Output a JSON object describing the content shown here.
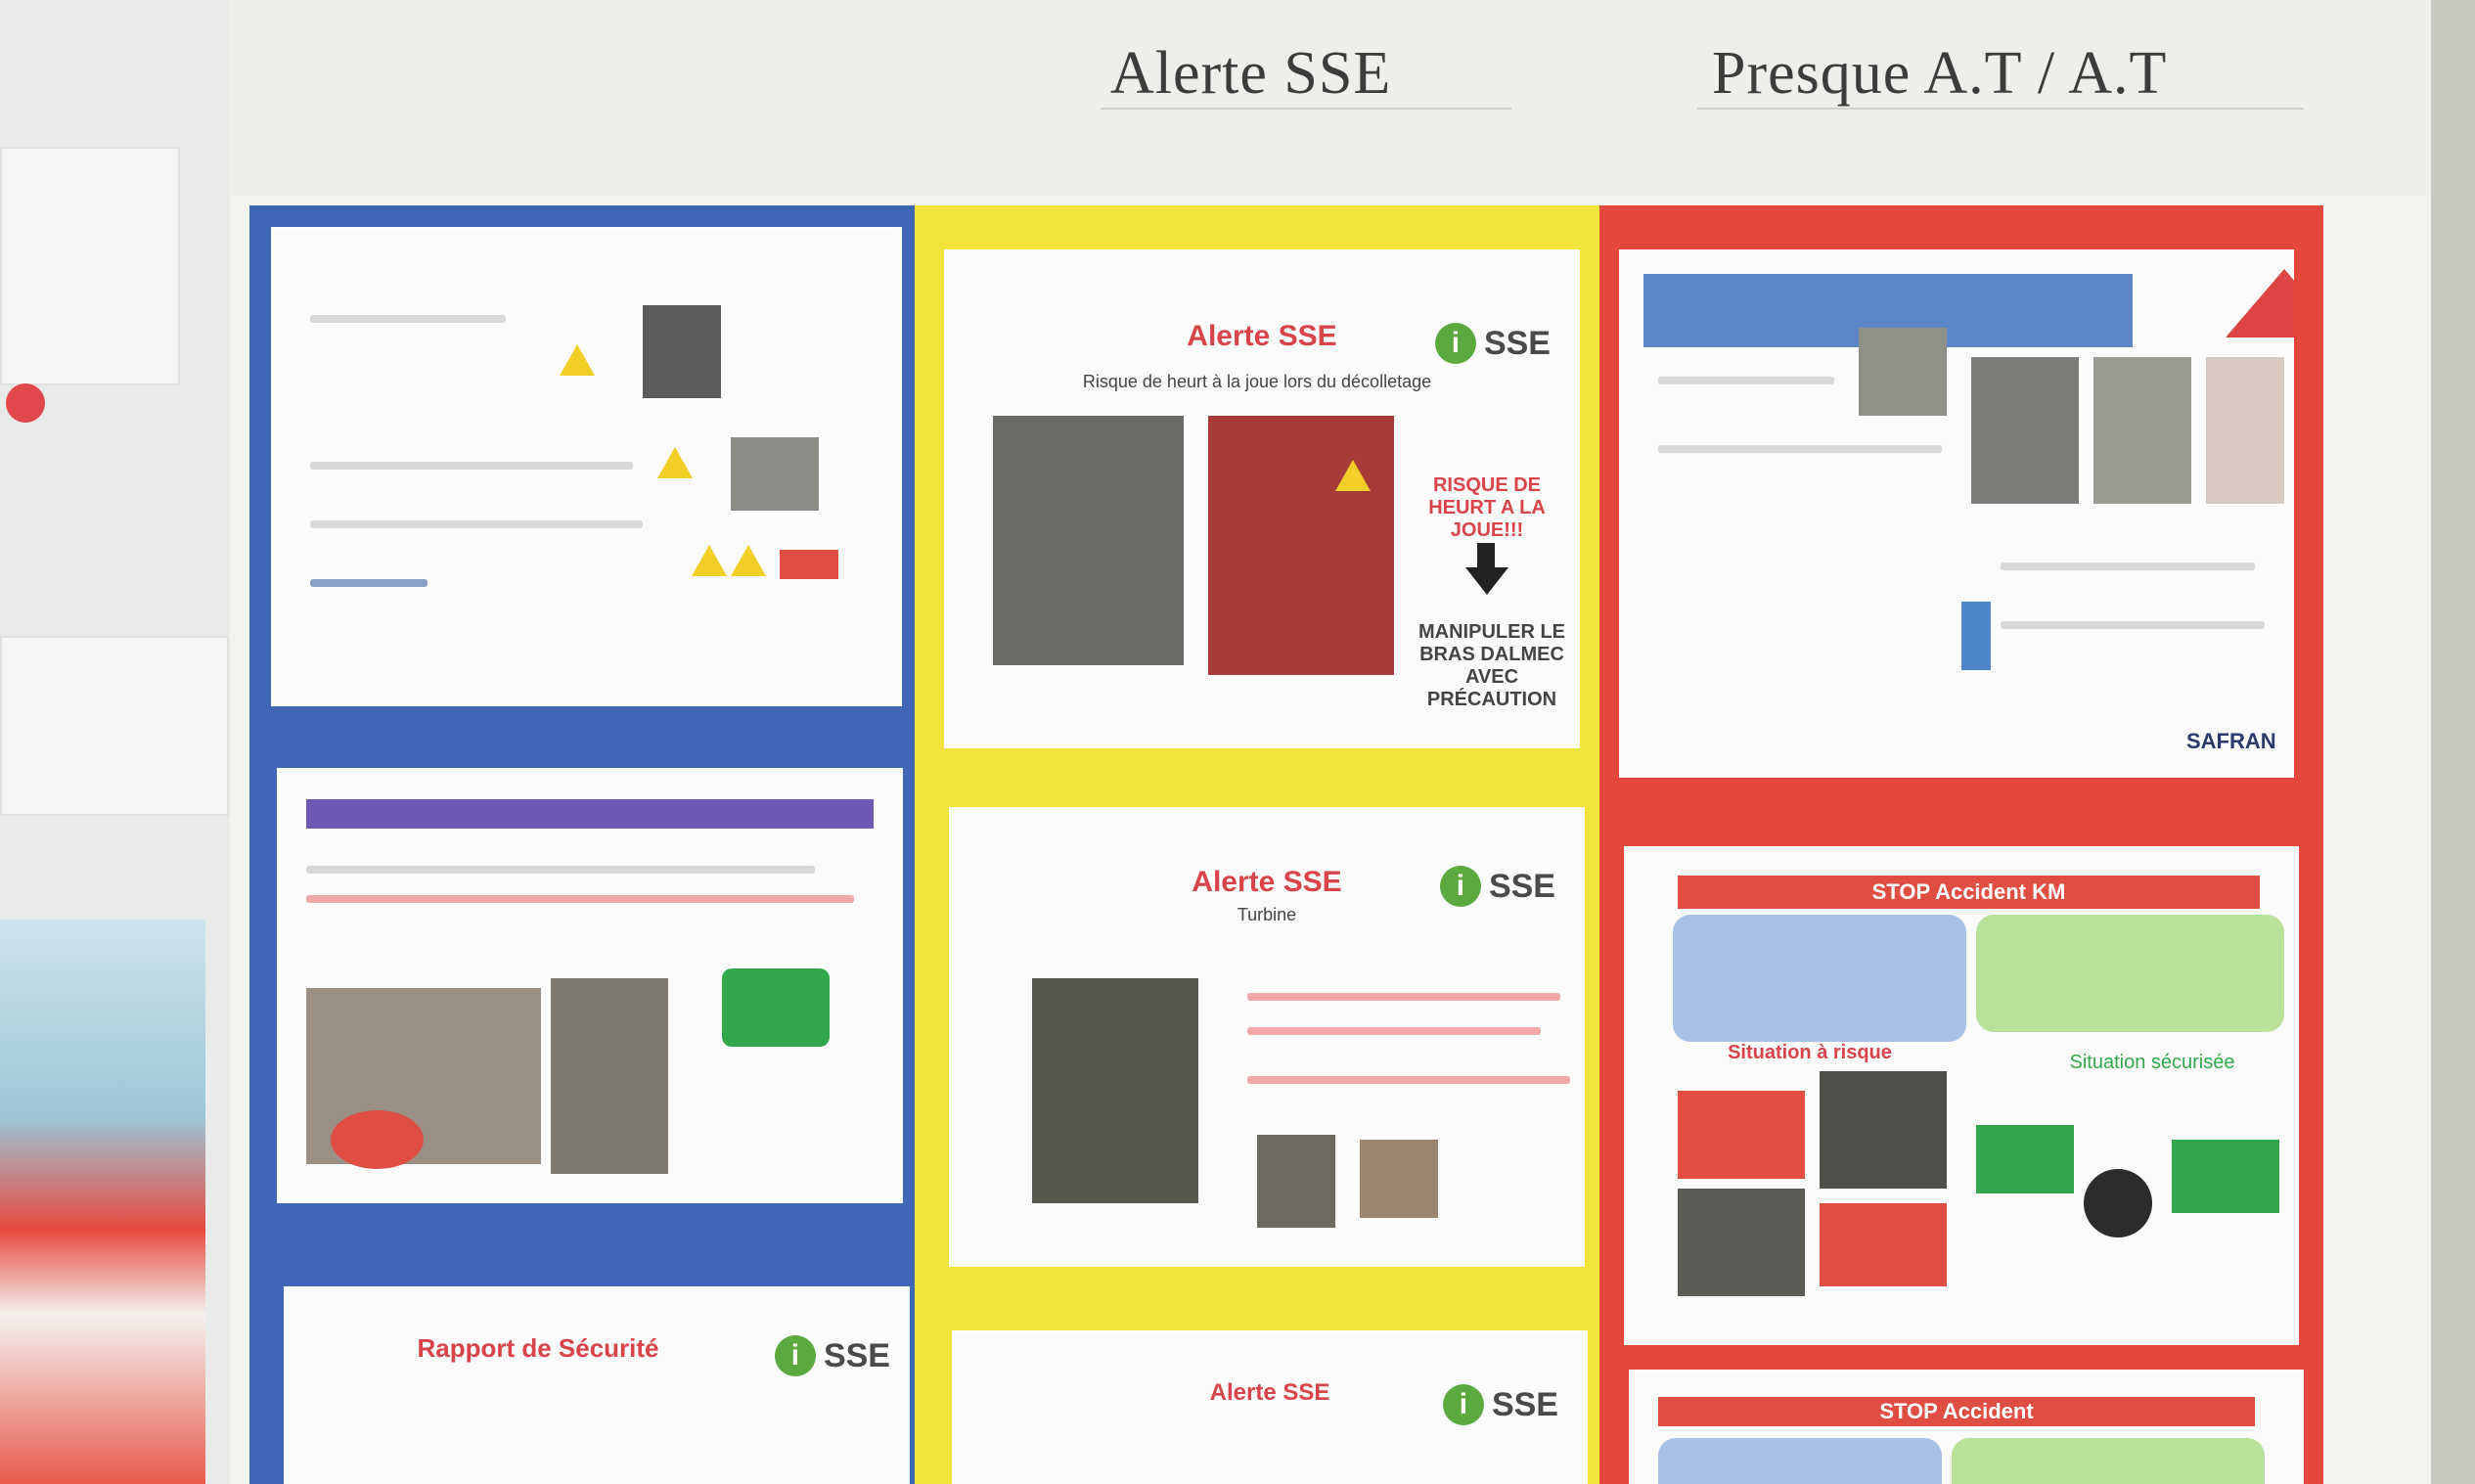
{
  "board": {
    "header_left": "Alerte SSE",
    "header_right": "Presque A.T / A.T"
  },
  "columns": {
    "blue": {
      "panel_2_title": "",
      "panel_3_title": "Rapport de Sécurité"
    },
    "yellow": {
      "panel_1": {
        "title": "Alerte SSE",
        "subtitle": "Risque de heurt à la joue lors du décolletage",
        "badge": "SSE",
        "risk_text": "RISQUE DE HEURT A LA JOUE!!!",
        "action_text": "MANIPULER LE BRAS DALMEC AVEC PRÉCAUTION"
      },
      "panel_2": {
        "title": "Alerte SSE",
        "subtitle": "Turbine",
        "badge": "SSE"
      },
      "panel_3": {
        "title": "Alerte SSE",
        "badge": "SSE"
      }
    },
    "red": {
      "panel_1": {
        "safran": "SAFRAN"
      },
      "panel_2": {
        "bar_title": "STOP Accident KM",
        "situation_a_risque": "Situation à risque",
        "situation_securisee": "Situation sécurisée"
      },
      "panel_3": {
        "bar_title": "STOP Accident"
      }
    }
  },
  "colors": {
    "blue_frame": "#3f67b5",
    "yellow_frame": "#f2e43a",
    "red_frame": "#e4483d",
    "alert_red": "#d9434a",
    "sse_green": "#5ba93f"
  }
}
